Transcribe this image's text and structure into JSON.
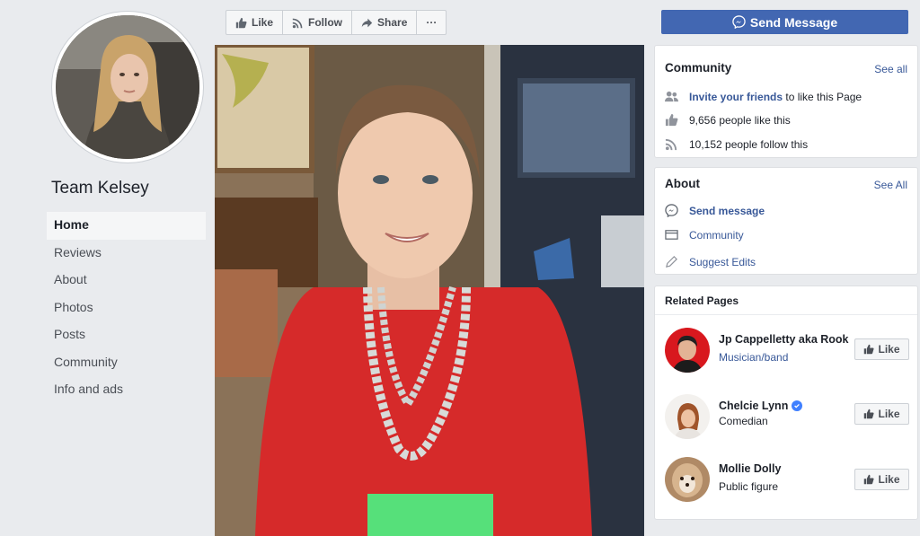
{
  "page": {
    "name": "Team Kelsey"
  },
  "nav": {
    "items": [
      {
        "label": "Home",
        "active": true
      },
      {
        "label": "Reviews"
      },
      {
        "label": "About"
      },
      {
        "label": "Photos"
      },
      {
        "label": "Posts"
      },
      {
        "label": "Community"
      },
      {
        "label": "Info and ads"
      }
    ]
  },
  "actions": {
    "like": "Like",
    "follow": "Follow",
    "share": "Share",
    "more": "···",
    "send_message": "Send Message"
  },
  "community": {
    "title": "Community",
    "see_all": "See all",
    "invite_link": "Invite your friends",
    "invite_rest": "to like this Page",
    "likes": "9,656 people like this",
    "follows": "10,152 people follow this"
  },
  "about": {
    "title": "About",
    "see_all": "See All",
    "send_message": "Send message",
    "community": "Community",
    "suggest_edits": "Suggest Edits"
  },
  "related": {
    "title": "Related Pages",
    "pages": [
      {
        "name": "Jp Cappelletty aka Rook",
        "sub": "Musician/band",
        "like": "Like"
      },
      {
        "name": "Chelcie Lynn",
        "sub": "Comedian",
        "like": "Like",
        "verified": true
      },
      {
        "name": "Mollie Dolly",
        "sub": "Public figure",
        "like": "Like"
      }
    ]
  },
  "colors": {
    "brand": "#4267b2",
    "link": "#385898",
    "background": "#e9ebee"
  }
}
